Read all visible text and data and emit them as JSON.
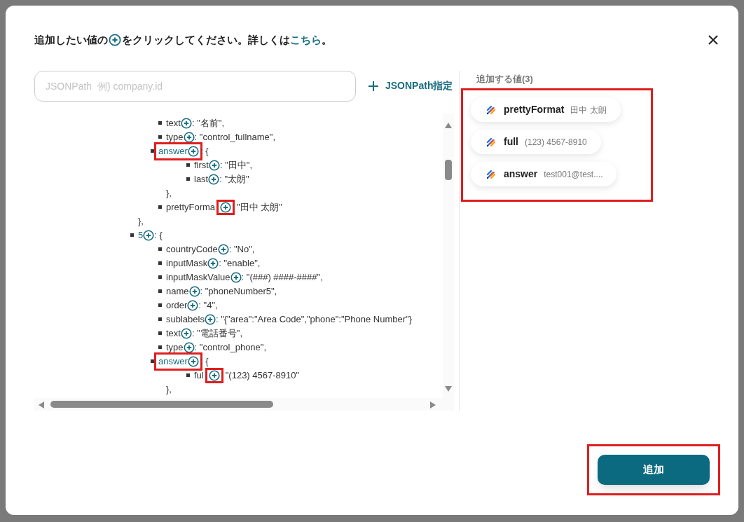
{
  "instruction": {
    "before": "追加したい値の",
    "after": "をクリックしてください。詳しくは",
    "link": "こちら",
    "end": "。"
  },
  "search": {
    "placeholder": "JSONPath  例) company.id"
  },
  "jsonpath_button": "JSONPath指定",
  "tree": [
    {
      "close": "},",
      "children": [
        {
          "key": "text",
          "rest": ": \"名前\","
        },
        {
          "key": "type",
          "rest": ": \"control_fullname\","
        },
        {
          "key": "answer",
          "rest": ": {",
          "key_highlighted": true,
          "close": "},",
          "children": [
            {
              "key": "first",
              "rest": ": \"田中\","
            },
            {
              "key": "last",
              "rest": ": \"太朗\""
            }
          ]
        },
        {
          "key": "prettyForma",
          "rest": "\"田中 太朗\"",
          "plus_highlighted": true
        }
      ]
    },
    {
      "key": "5",
      "rest": ": {",
      "children": [
        {
          "key": "countryCode",
          "rest": ": \"No\","
        },
        {
          "key": "inputMask",
          "rest": ": \"enable\","
        },
        {
          "key": "inputMaskValue",
          "rest": ": \"(###) ####-####\","
        },
        {
          "key": "name",
          "rest": ": \"phoneNumber5\","
        },
        {
          "key": "order",
          "rest": ": \"4\","
        },
        {
          "key": "sublabels",
          "rest": ": \"{\"area\":\"Area Code\",\"phone\":\"Phone Number\"}"
        },
        {
          "key": "text",
          "rest": ": \"電話番号\","
        },
        {
          "key": "type",
          "rest": ": \"control_phone\","
        },
        {
          "key": "answer",
          "rest": ": {",
          "key_highlighted": true,
          "close": "},",
          "children": [
            {
              "key": "ful",
              "rest": "\"(123) 4567-8910\"",
              "plus_highlighted": true
            }
          ]
        }
      ]
    }
  ],
  "selected_panel": {
    "title": "追加する値(3)",
    "highlighted": true,
    "items": [
      {
        "name": "prettyFormat",
        "value": "田中 太朗"
      },
      {
        "name": "full",
        "value": "(123) 4567-8910"
      },
      {
        "name": "answer",
        "value": "test001@test...."
      }
    ]
  },
  "add_button": {
    "label": "追加",
    "highlighted": true
  }
}
